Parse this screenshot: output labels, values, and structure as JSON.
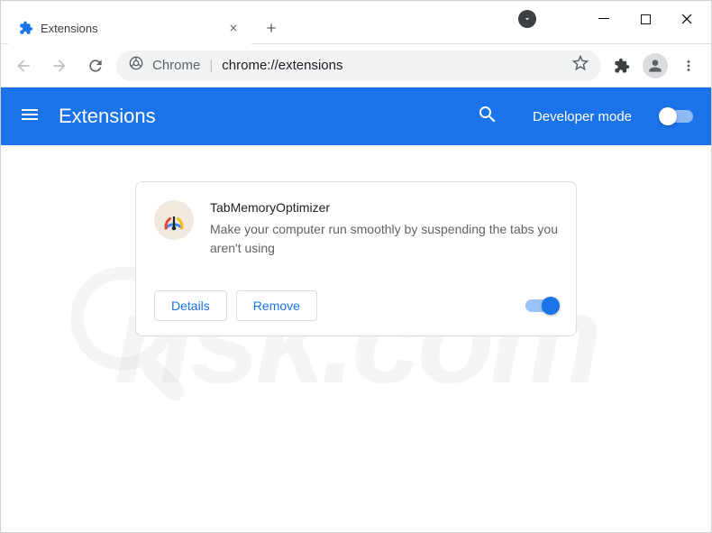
{
  "window": {
    "tab_title": "Extensions"
  },
  "omnibox": {
    "prefix": "Chrome",
    "url": "chrome://extensions"
  },
  "header": {
    "title": "Extensions",
    "dev_mode_label": "Developer mode",
    "dev_mode_on": false
  },
  "extension": {
    "name": "TabMemoryOptimizer",
    "description": "Make your computer run smoothly by suspending the tabs you aren't using",
    "details_label": "Details",
    "remove_label": "Remove",
    "enabled": true
  },
  "watermark": {
    "text": "risk.com"
  }
}
